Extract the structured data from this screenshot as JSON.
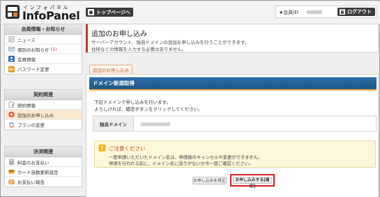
{
  "header": {
    "logo_kana": "インフォパネル",
    "logo_text": "InfoPanel",
    "top_page_label": "トップページへ",
    "member_label": "★会員ID",
    "logout_label": "ログアウト"
  },
  "sidebar": {
    "blocks": [
      {
        "title": "会員情報・お知らせ",
        "items": [
          {
            "label": "ニュース",
            "icon": "news-icon"
          },
          {
            "label": "個別のお知らせ",
            "count": "(1)",
            "icon": "mail-icon"
          },
          {
            "label": "会員情報",
            "icon": "person-icon"
          },
          {
            "label": "パスワード変更",
            "icon": "key-icon"
          }
        ]
      },
      {
        "title": "契約関連",
        "items": [
          {
            "label": "契約情報",
            "icon": "contract-icon"
          },
          {
            "label": "追加のお申し込み",
            "icon": "plus-circle-icon",
            "active": true
          },
          {
            "label": "プランの変更",
            "icon": "refresh-icon"
          }
        ]
      },
      {
        "title": "決済関連",
        "items": [
          {
            "label": "料金のお支払い",
            "icon": "calculator-icon"
          },
          {
            "label": "カード自動更新設定",
            "icon": "card-icon"
          },
          {
            "label": "お支払い報告",
            "icon": "report-icon"
          }
        ]
      }
    ]
  },
  "main": {
    "title": "追加のお申し込み",
    "desc_line1": "サーバーアカウント、独自ドメインの追加お申し込みを行うことができます。",
    "desc_line2": "住所などの情報を入力する必要はありません。",
    "tab_label": "追加のお申し込み",
    "section_title": "ドメイン新規取得",
    "intro_line1": "下記ドメインで申し込みを行います。",
    "intro_line2": "よろしければ、確定ボタンをクリックしてください。",
    "domain_label": "独自ドメイン",
    "notice_title": "ご注意ください",
    "notice_line1": "一度申請いただいたドメイン名は、申請後のキャンセルや変更ができません。",
    "notice_line2": "申請を行われる前に、ドメイン名に誤りがないか今一度ご確認ください。",
    "fix_button": "お申し込みを修正",
    "confirm_button": "お申し込みする[確定]"
  },
  "colors": {
    "section_bar": "#1d5688",
    "accent_orange": "#f0a04b",
    "highlight_red": "#d81b1b",
    "notice_bg": "#fdf7dc"
  }
}
